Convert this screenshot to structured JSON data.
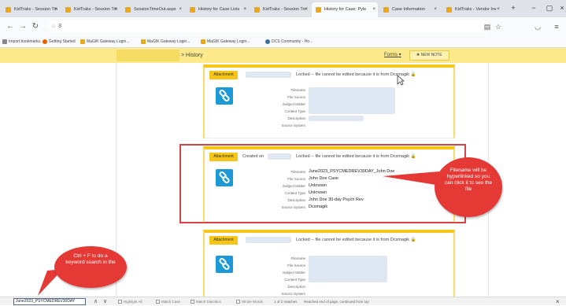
{
  "browser": {
    "tabs": [
      {
        "label": "KidTraks - Session Tin"
      },
      {
        "label": "KidTraks - Session Tin"
      },
      {
        "label": "SessionTimeOut.aspx"
      },
      {
        "label": "History for Case Lists"
      },
      {
        "label": "KidTraks - Session Tin"
      },
      {
        "label": "History for Case: Pyle"
      },
      {
        "label": "Case Information"
      },
      {
        "label": "KidTraks - Vendor Inv"
      }
    ],
    "url": "8",
    "bookmarks": [
      {
        "label": "Import bookmarks..."
      },
      {
        "label": "Getting Started"
      },
      {
        "label": "MaGIK Gateway Login..."
      },
      {
        "label": "MaGIK Gateway Login..."
      },
      {
        "label": "MaGIK Gateway Login..."
      },
      {
        "label": "DCS Community - Ho..."
      }
    ]
  },
  "header": {
    "title": "> History",
    "forms_label": "Forms",
    "new_note_label": "NEW NOTE"
  },
  "cards": [
    {
      "badge": "Attachment",
      "created_on": "",
      "locked_text": "Locked -- file cannot be edited because it is from Dcsmagik",
      "labels": [
        "Filename",
        "File Source",
        "Subject Matter",
        "Content Type",
        "Description",
        "Source System"
      ],
      "values": [
        "",
        "",
        "",
        "",
        "",
        ""
      ]
    },
    {
      "badge": "Attachment",
      "created_on": "Created on",
      "locked_text": "Locked -- file cannot be edited because it is from Dcsmagik",
      "labels": [
        "Filename",
        "File Source",
        "Subject Matter",
        "Content Type",
        "Description",
        "Source System"
      ],
      "values": [
        "June2023_PSYCMEDREV30DAY_John Doe",
        "John Doe Case",
        "Unknown",
        "Unknown",
        "John Doe 30-day Psych Rev",
        "Dcsmagik"
      ]
    },
    {
      "badge": "Attachment",
      "created_on": "",
      "locked_text": "Locked -- file cannot be edited because it is from Dcsmagik",
      "labels": [
        "Filename",
        "File Source",
        "Subject Matter",
        "Content Type",
        "Description",
        "Source System"
      ],
      "values": [
        "",
        "",
        "",
        "",
        "",
        ""
      ]
    }
  ],
  "callouts": {
    "filename_note": "Filename will be hyperlinked so you can click it to see the file",
    "search_note": "Ctrl + F to do a keyword search in the"
  },
  "findbar": {
    "query": "June2023_PSYCMEDREV30DAY",
    "options": [
      "Highlight All",
      "Match Case",
      "Match Diacritics",
      "Whole Words"
    ],
    "matches": "1 of 2 matches",
    "status": "Reached end of page, continued from top"
  },
  "colors": {
    "header_yellow": "#fce98c",
    "accent_yellow": "#f5c518",
    "icon_blue": "#1d9ad6",
    "callout_red": "#e53935",
    "highlight_border": "#d64545"
  }
}
